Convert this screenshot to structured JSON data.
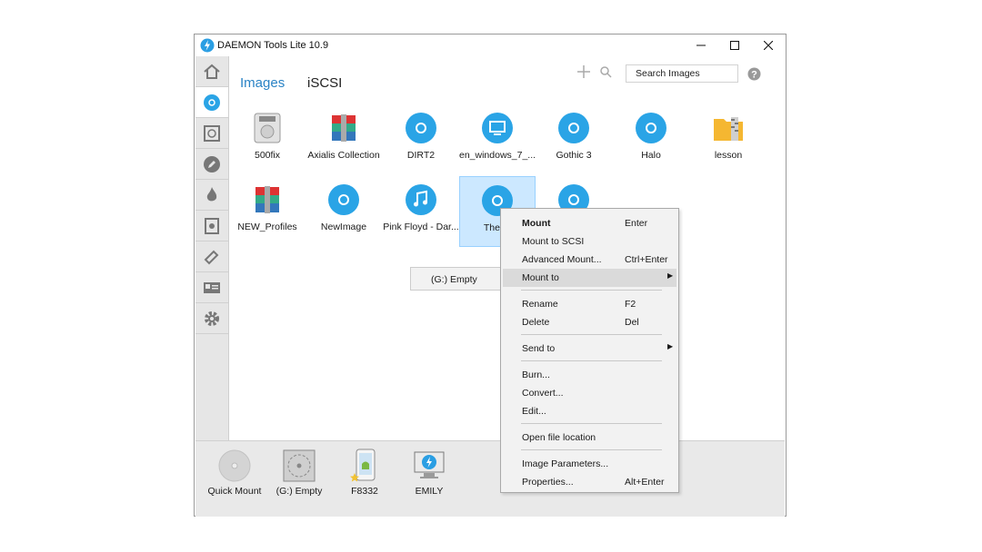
{
  "window": {
    "title": "DAEMON Tools Lite 10.9"
  },
  "sidebar": {
    "items": [
      {
        "icon": "home-icon"
      },
      {
        "icon": "disc-icon",
        "active": true
      },
      {
        "icon": "virtual-drive-icon"
      },
      {
        "icon": "pencil-icon"
      },
      {
        "icon": "flame-icon"
      },
      {
        "icon": "vhd-icon"
      },
      {
        "icon": "usb-icon"
      },
      {
        "icon": "contacts-icon"
      },
      {
        "icon": "gear-icon"
      }
    ]
  },
  "tabs": {
    "images": "Images",
    "iscsi": "iSCSI"
  },
  "search": {
    "label": "Search Images"
  },
  "images": [
    {
      "label": "500fix",
      "icon": "hdd-icon"
    },
    {
      "label": "Axialis Collection",
      "icon": "archive-icon"
    },
    {
      "label": "DIRT2",
      "icon": "disc-icon"
    },
    {
      "label": "en_windows_7_...",
      "icon": "monitor-icon"
    },
    {
      "label": "Gothic 3",
      "icon": "disc-icon"
    },
    {
      "label": "Halo",
      "icon": "disc-icon"
    },
    {
      "label": "lesson",
      "icon": "zip-folder-icon"
    },
    {
      "label": "NEW_Profiles",
      "icon": "archive-icon"
    },
    {
      "label": "NewImage",
      "icon": "disc-icon"
    },
    {
      "label": "Pink Floyd - Dar...",
      "icon": "music-icon"
    },
    {
      "label": "TheWi",
      "icon": "disc-icon",
      "selected": true
    },
    {
      "label": "",
      "icon": "disc-icon"
    }
  ],
  "submenu": {
    "item": "(G:) Empty"
  },
  "drives": [
    {
      "label": "Quick Mount",
      "icon": "quick-mount-icon"
    },
    {
      "label": "(G:) Empty",
      "icon": "empty-drive-icon"
    },
    {
      "label": "F8332",
      "icon": "android-phone-icon"
    },
    {
      "label": "EMILY",
      "icon": "daemon-pc-icon"
    }
  ],
  "context_menu": {
    "mount": {
      "label": "Mount",
      "shortcut": "Enter"
    },
    "mount_scsi": {
      "label": "Mount to SCSI"
    },
    "advanced_mount": {
      "label": "Advanced Mount...",
      "shortcut": "Ctrl+Enter"
    },
    "mount_to": {
      "label": "Mount to"
    },
    "rename": {
      "label": "Rename",
      "shortcut": "F2"
    },
    "delete": {
      "label": "Delete",
      "shortcut": "Del"
    },
    "send_to": {
      "label": "Send to"
    },
    "burn": {
      "label": "Burn..."
    },
    "convert": {
      "label": "Convert..."
    },
    "edit": {
      "label": "Edit..."
    },
    "open_location": {
      "label": "Open file location"
    },
    "image_params": {
      "label": "Image Parameters..."
    },
    "properties": {
      "label": "Properties...",
      "shortcut": "Alt+Enter"
    }
  },
  "colors": {
    "accent": "#2a83c5",
    "disc": "#2aa4e6",
    "selection": "#cce8ff"
  }
}
